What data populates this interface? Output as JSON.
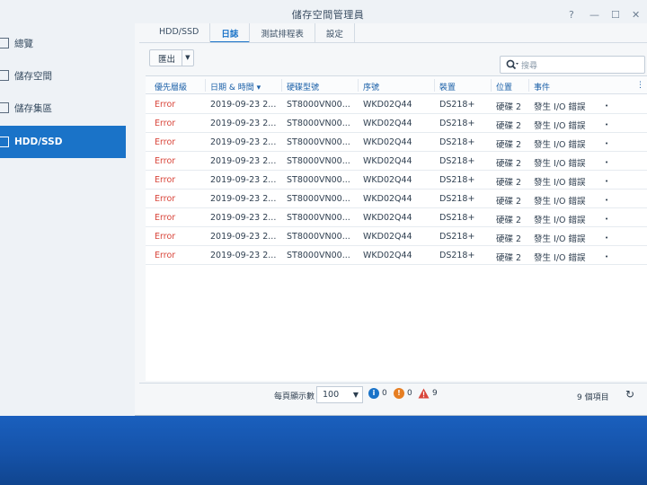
{
  "window": {
    "title": "儲存空間管理員"
  },
  "sidebar": {
    "items": [
      {
        "label": "總覽"
      },
      {
        "label": "儲存空間"
      },
      {
        "label": "儲存集區"
      },
      {
        "label": "HDD/SSD"
      }
    ]
  },
  "tabs": [
    {
      "label": "HDD/SSD"
    },
    {
      "label": "日誌"
    },
    {
      "label": "測試排程表"
    },
    {
      "label": "設定"
    }
  ],
  "toolbar": {
    "export_label": "匯出",
    "search_placeholder": "搜尋"
  },
  "table": {
    "columns": [
      "優先層級",
      "日期 & 時間",
      "硬碟型號",
      "序號",
      "裝置",
      "位置",
      "事件"
    ],
    "rows": [
      [
        "Error",
        "2019-09-23 2...",
        "ST8000VN00...",
        "WKD02Q44",
        "DS218+",
        "硬碟 2",
        "發生 I/O 錯誤"
      ],
      [
        "Error",
        "2019-09-23 2...",
        "ST8000VN00...",
        "WKD02Q44",
        "DS218+",
        "硬碟 2",
        "發生 I/O 錯誤"
      ],
      [
        "Error",
        "2019-09-23 2...",
        "ST8000VN00...",
        "WKD02Q44",
        "DS218+",
        "硬碟 2",
        "發生 I/O 錯誤"
      ],
      [
        "Error",
        "2019-09-23 2...",
        "ST8000VN00...",
        "WKD02Q44",
        "DS218+",
        "硬碟 2",
        "發生 I/O 錯誤"
      ],
      [
        "Error",
        "2019-09-23 2...",
        "ST8000VN00...",
        "WKD02Q44",
        "DS218+",
        "硬碟 2",
        "發生 I/O 錯誤"
      ],
      [
        "Error",
        "2019-09-23 2...",
        "ST8000VN00...",
        "WKD02Q44",
        "DS218+",
        "硬碟 2",
        "發生 I/O 錯誤"
      ],
      [
        "Error",
        "2019-09-23 2...",
        "ST8000VN00...",
        "WKD02Q44",
        "DS218+",
        "硬碟 2",
        "發生 I/O 錯誤"
      ],
      [
        "Error",
        "2019-09-23 2...",
        "ST8000VN00...",
        "WKD02Q44",
        "DS218+",
        "硬碟 2",
        "發生 I/O 錯誤"
      ],
      [
        "Error",
        "2019-09-23 2...",
        "ST8000VN00...",
        "WKD02Q44",
        "DS218+",
        "硬碟 2",
        "發生 I/O 錯誤"
      ]
    ]
  },
  "footer": {
    "per_page_label": "每頁顯示數",
    "per_page_value": "100",
    "info_count": "0",
    "warning_count": "0",
    "error_count": "9",
    "total_label": "9 個項目"
  },
  "colors": {
    "accent": "#1a73c8",
    "error": "#d9463b",
    "info": "#1a73c8",
    "warning": "#e67e22"
  }
}
